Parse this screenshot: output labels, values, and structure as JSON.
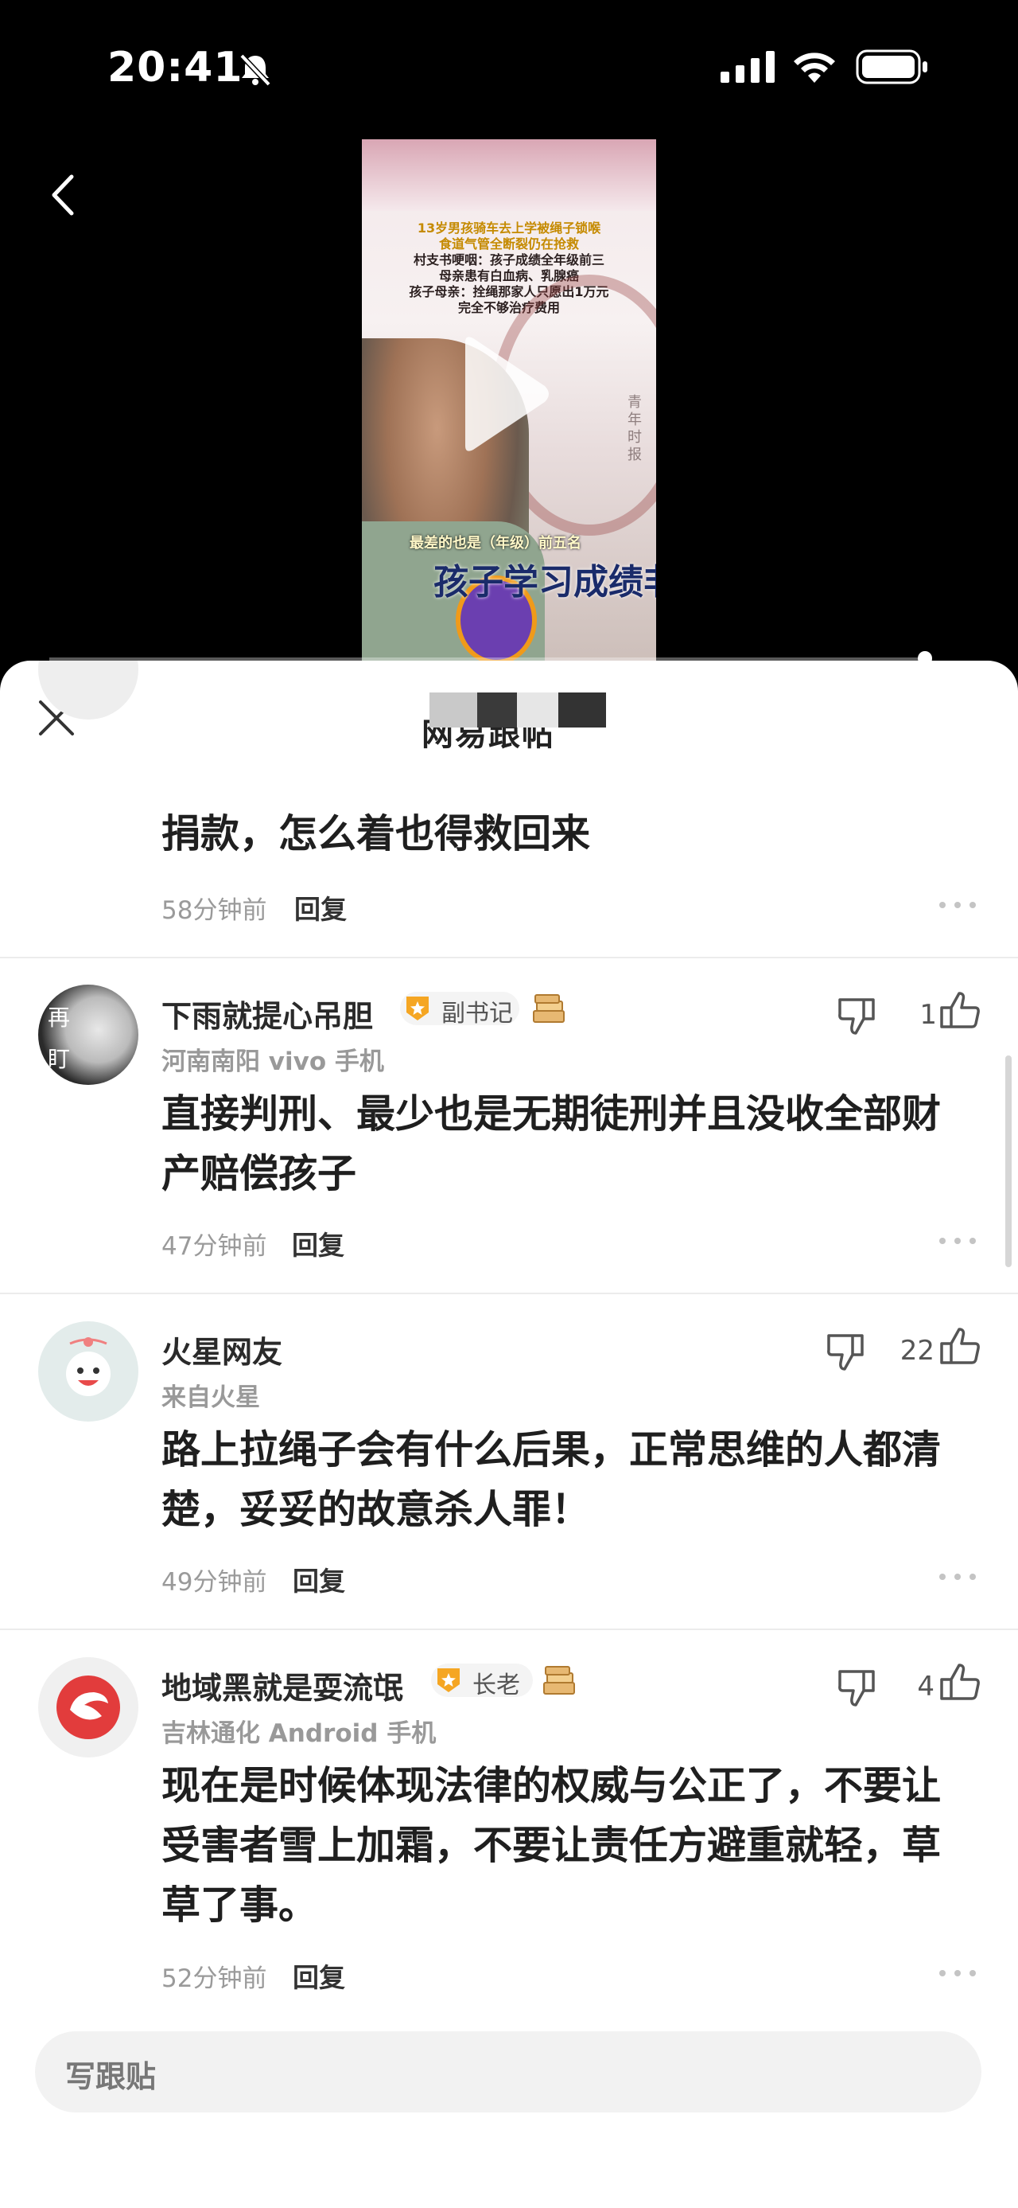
{
  "status_bar": {
    "time": "20:41"
  },
  "video": {
    "caption_line1": "13岁男孩骑车去上学被绳子锁喉",
    "caption_line2": "食道气管全断裂仍在抢救",
    "caption_line3": "村支书哽咽：孩子成绩全年级前三",
    "caption_line4": "母亲患有白血病、乳腺癌",
    "caption_line5": "孩子母亲：拴绳那家人只愿出1万元",
    "caption_line6": "完全不够治疗费用",
    "subtitle_small": "最差的也是（年级）前五名",
    "subtitle_big": "孩子学习成绩非常",
    "watermark": "青年时报"
  },
  "sheet": {
    "title": "网易跟帖",
    "write_placeholder": "写跟贴"
  },
  "comments": [
    {
      "body": "捐款，怎么着也得救回来",
      "time": "58分钟前",
      "reply": "回复"
    },
    {
      "avatar_text1": "再",
      "avatar_text2": "盯",
      "username": "下雨就提心吊胆",
      "badge": "副书记",
      "location": "河南南阳  vivo 手机",
      "likes": "1",
      "body": "直接判刑、最少也是无期徒刑并且没收全部财产赔偿孩子",
      "time": "47分钟前",
      "reply": "回复"
    },
    {
      "username": "火星网友",
      "location": "来自火星",
      "likes": "22",
      "body": "路上拉绳子会有什么后果，正常思维的人都清楚，妥妥的故意杀人罪！",
      "time": "49分钟前",
      "reply": "回复"
    },
    {
      "username": "地域黑就是耍流氓",
      "badge": "长老",
      "location": "吉林通化  Android 手机",
      "likes": "4",
      "body": "现在是时候体现法律的权威与公正了，不要让受害者雪上加霜，不要让责任方避重就轻，草草了事。",
      "time": "52分钟前",
      "reply": "回复"
    }
  ],
  "colors": {
    "accent_orange": "#f5a623",
    "background": "#ffffff",
    "text_primary": "#1f1f1f",
    "text_secondary": "#9a9a9a"
  },
  "icons": [
    "bell-slash-icon",
    "signal-icon",
    "wifi-icon",
    "battery-icon",
    "back-icon",
    "play-icon",
    "close-icon",
    "thumb-down-icon",
    "thumb-up-icon",
    "more-icon",
    "badge-icon",
    "book-icon"
  ]
}
